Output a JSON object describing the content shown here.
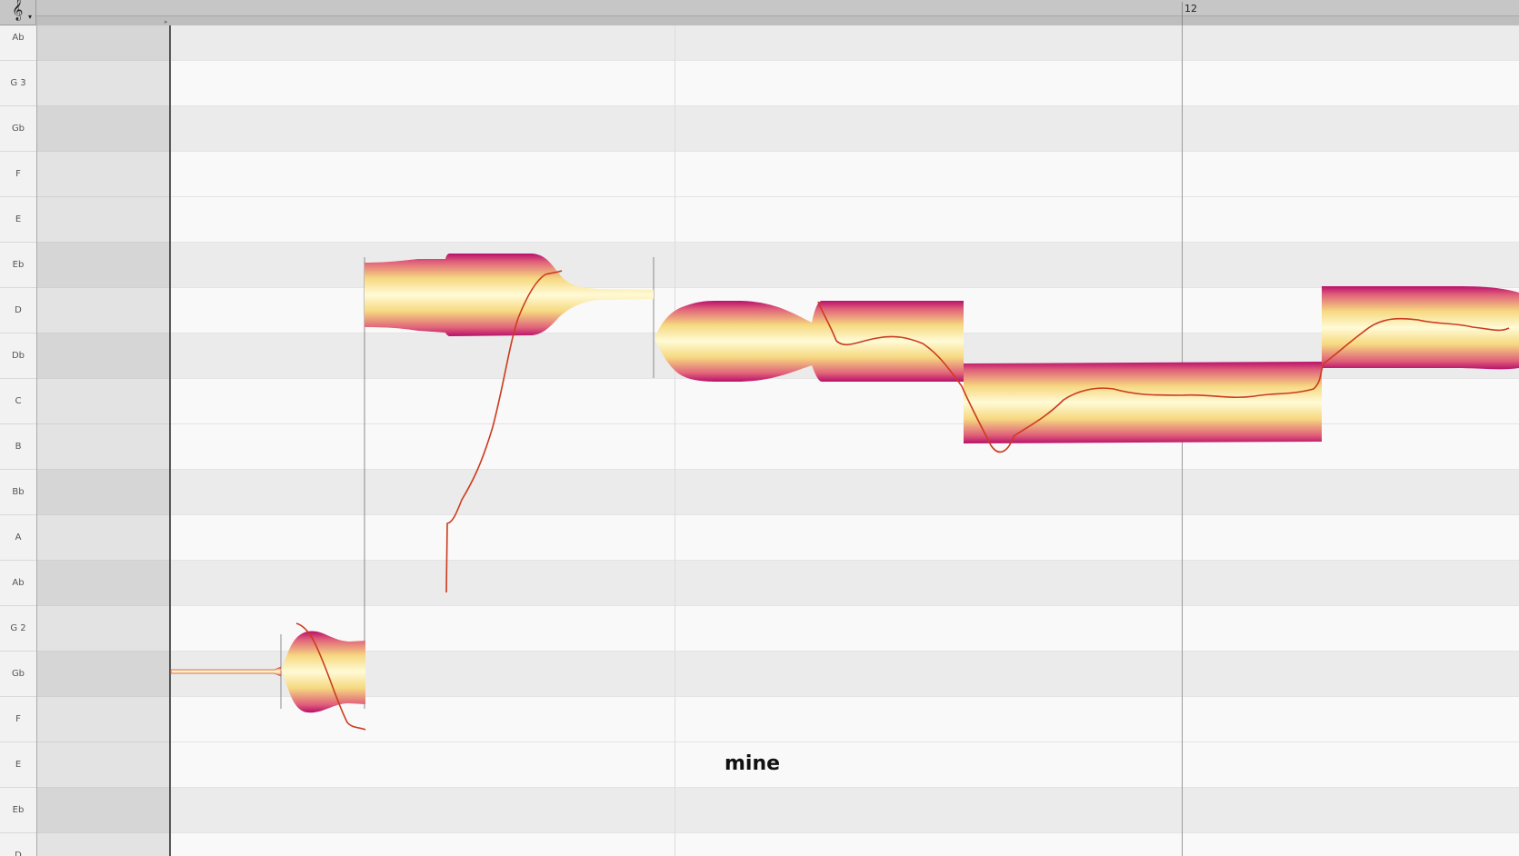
{
  "ruler": {
    "clef_icon": "treble-clef-icon",
    "clef_glyph": "𝄞",
    "caret_glyph": "▾",
    "bar_number": "12"
  },
  "pitch_labels": [
    "Ab",
    "G 3",
    "Gb",
    "F",
    "E",
    "Eb",
    "D",
    "Db",
    "C",
    "B",
    "Bb",
    "A",
    "Ab",
    "G 2",
    "Gb",
    "F",
    "E",
    "Eb",
    "D"
  ],
  "lyric": "mine",
  "colors": {
    "blob_core": "#fffbd6",
    "blob_mid": "#f6d880",
    "blob_edge": "#e0607a",
    "blob_outline": "#b8106a",
    "pitch_curve": "#cc3b1e",
    "white_lane": "#f9f9f9",
    "black_lane": "#ebebeb"
  }
}
